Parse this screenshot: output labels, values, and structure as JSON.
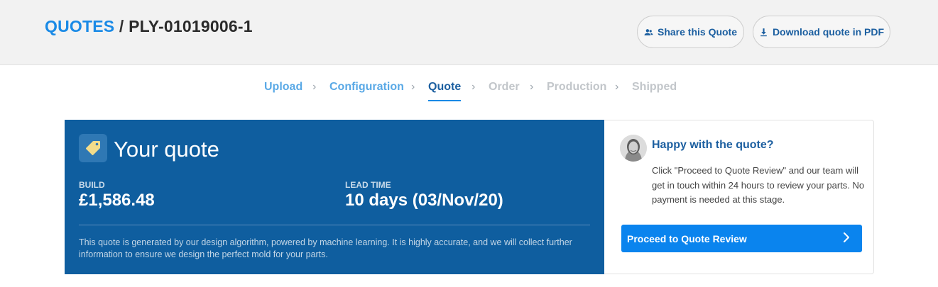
{
  "header": {
    "breadcrumb_root": "QUOTES",
    "breadcrumb_sep": "/",
    "quote_id": "PLY-01019006-1",
    "share_label": "Share this Quote",
    "download_label": "Download quote in PDF"
  },
  "steps": [
    {
      "label": "Upload",
      "state": "done"
    },
    {
      "label": "Configuration",
      "state": "done"
    },
    {
      "label": "Quote",
      "state": "active"
    },
    {
      "label": "Order",
      "state": "todo"
    },
    {
      "label": "Production",
      "state": "todo"
    },
    {
      "label": "Shipped",
      "state": "todo"
    }
  ],
  "step_separator": "›",
  "quote": {
    "title": "Your quote",
    "build_label": "BUILD",
    "build_value": "£1,586.48",
    "lead_label": "LEAD TIME",
    "lead_value": "10 days (03/Nov/20)",
    "disclaimer": "This quote is generated by our design algorithm, powered by machine learning. It is highly accurate, and we will collect further information to ensure we design the perfect mold for your parts."
  },
  "side": {
    "title": "Happy with the quote?",
    "text": "Click \"Proceed to Quote Review\" and our team will get in touch within 24 hours to review your parts. No payment is needed at this stage.",
    "proceed_label": "Proceed to Quote Review"
  },
  "colors": {
    "brand_blue": "#1a8ae6",
    "panel_blue": "#0f5e9f",
    "button_blue": "#0a84ee",
    "tag_icon": "#f3dc8a"
  },
  "icons": {
    "share": "people-icon",
    "download": "download-icon",
    "tag": "price-tag-icon",
    "proceed": "chevron-right-icon"
  }
}
